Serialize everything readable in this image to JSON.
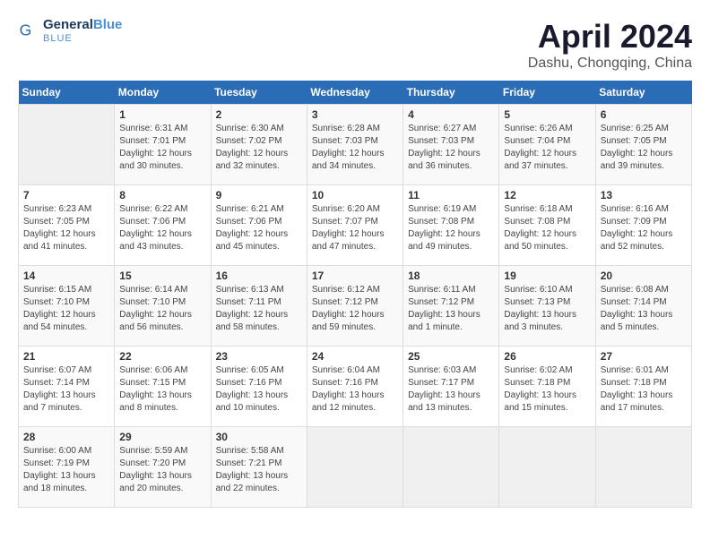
{
  "logo": {
    "text_general": "General",
    "text_blue": "Blue"
  },
  "title": "April 2024",
  "location": "Dashu, Chongqing, China",
  "headers": [
    "Sunday",
    "Monday",
    "Tuesday",
    "Wednesday",
    "Thursday",
    "Friday",
    "Saturday"
  ],
  "weeks": [
    [
      {
        "day": "",
        "content": ""
      },
      {
        "day": "1",
        "content": "Sunrise: 6:31 AM\nSunset: 7:01 PM\nDaylight: 12 hours\nand 30 minutes."
      },
      {
        "day": "2",
        "content": "Sunrise: 6:30 AM\nSunset: 7:02 PM\nDaylight: 12 hours\nand 32 minutes."
      },
      {
        "day": "3",
        "content": "Sunrise: 6:28 AM\nSunset: 7:03 PM\nDaylight: 12 hours\nand 34 minutes."
      },
      {
        "day": "4",
        "content": "Sunrise: 6:27 AM\nSunset: 7:03 PM\nDaylight: 12 hours\nand 36 minutes."
      },
      {
        "day": "5",
        "content": "Sunrise: 6:26 AM\nSunset: 7:04 PM\nDaylight: 12 hours\nand 37 minutes."
      },
      {
        "day": "6",
        "content": "Sunrise: 6:25 AM\nSunset: 7:05 PM\nDaylight: 12 hours\nand 39 minutes."
      }
    ],
    [
      {
        "day": "7",
        "content": "Sunrise: 6:23 AM\nSunset: 7:05 PM\nDaylight: 12 hours\nand 41 minutes."
      },
      {
        "day": "8",
        "content": "Sunrise: 6:22 AM\nSunset: 7:06 PM\nDaylight: 12 hours\nand 43 minutes."
      },
      {
        "day": "9",
        "content": "Sunrise: 6:21 AM\nSunset: 7:06 PM\nDaylight: 12 hours\nand 45 minutes."
      },
      {
        "day": "10",
        "content": "Sunrise: 6:20 AM\nSunset: 7:07 PM\nDaylight: 12 hours\nand 47 minutes."
      },
      {
        "day": "11",
        "content": "Sunrise: 6:19 AM\nSunset: 7:08 PM\nDaylight: 12 hours\nand 49 minutes."
      },
      {
        "day": "12",
        "content": "Sunrise: 6:18 AM\nSunset: 7:08 PM\nDaylight: 12 hours\nand 50 minutes."
      },
      {
        "day": "13",
        "content": "Sunrise: 6:16 AM\nSunset: 7:09 PM\nDaylight: 12 hours\nand 52 minutes."
      }
    ],
    [
      {
        "day": "14",
        "content": "Sunrise: 6:15 AM\nSunset: 7:10 PM\nDaylight: 12 hours\nand 54 minutes."
      },
      {
        "day": "15",
        "content": "Sunrise: 6:14 AM\nSunset: 7:10 PM\nDaylight: 12 hours\nand 56 minutes."
      },
      {
        "day": "16",
        "content": "Sunrise: 6:13 AM\nSunset: 7:11 PM\nDaylight: 12 hours\nand 58 minutes."
      },
      {
        "day": "17",
        "content": "Sunrise: 6:12 AM\nSunset: 7:12 PM\nDaylight: 12 hours\nand 59 minutes."
      },
      {
        "day": "18",
        "content": "Sunrise: 6:11 AM\nSunset: 7:12 PM\nDaylight: 13 hours\nand 1 minute."
      },
      {
        "day": "19",
        "content": "Sunrise: 6:10 AM\nSunset: 7:13 PM\nDaylight: 13 hours\nand 3 minutes."
      },
      {
        "day": "20",
        "content": "Sunrise: 6:08 AM\nSunset: 7:14 PM\nDaylight: 13 hours\nand 5 minutes."
      }
    ],
    [
      {
        "day": "21",
        "content": "Sunrise: 6:07 AM\nSunset: 7:14 PM\nDaylight: 13 hours\nand 7 minutes."
      },
      {
        "day": "22",
        "content": "Sunrise: 6:06 AM\nSunset: 7:15 PM\nDaylight: 13 hours\nand 8 minutes."
      },
      {
        "day": "23",
        "content": "Sunrise: 6:05 AM\nSunset: 7:16 PM\nDaylight: 13 hours\nand 10 minutes."
      },
      {
        "day": "24",
        "content": "Sunrise: 6:04 AM\nSunset: 7:16 PM\nDaylight: 13 hours\nand 12 minutes."
      },
      {
        "day": "25",
        "content": "Sunrise: 6:03 AM\nSunset: 7:17 PM\nDaylight: 13 hours\nand 13 minutes."
      },
      {
        "day": "26",
        "content": "Sunrise: 6:02 AM\nSunset: 7:18 PM\nDaylight: 13 hours\nand 15 minutes."
      },
      {
        "day": "27",
        "content": "Sunrise: 6:01 AM\nSunset: 7:18 PM\nDaylight: 13 hours\nand 17 minutes."
      }
    ],
    [
      {
        "day": "28",
        "content": "Sunrise: 6:00 AM\nSunset: 7:19 PM\nDaylight: 13 hours\nand 18 minutes."
      },
      {
        "day": "29",
        "content": "Sunrise: 5:59 AM\nSunset: 7:20 PM\nDaylight: 13 hours\nand 20 minutes."
      },
      {
        "day": "30",
        "content": "Sunrise: 5:58 AM\nSunset: 7:21 PM\nDaylight: 13 hours\nand 22 minutes."
      },
      {
        "day": "",
        "content": ""
      },
      {
        "day": "",
        "content": ""
      },
      {
        "day": "",
        "content": ""
      },
      {
        "day": "",
        "content": ""
      }
    ]
  ]
}
